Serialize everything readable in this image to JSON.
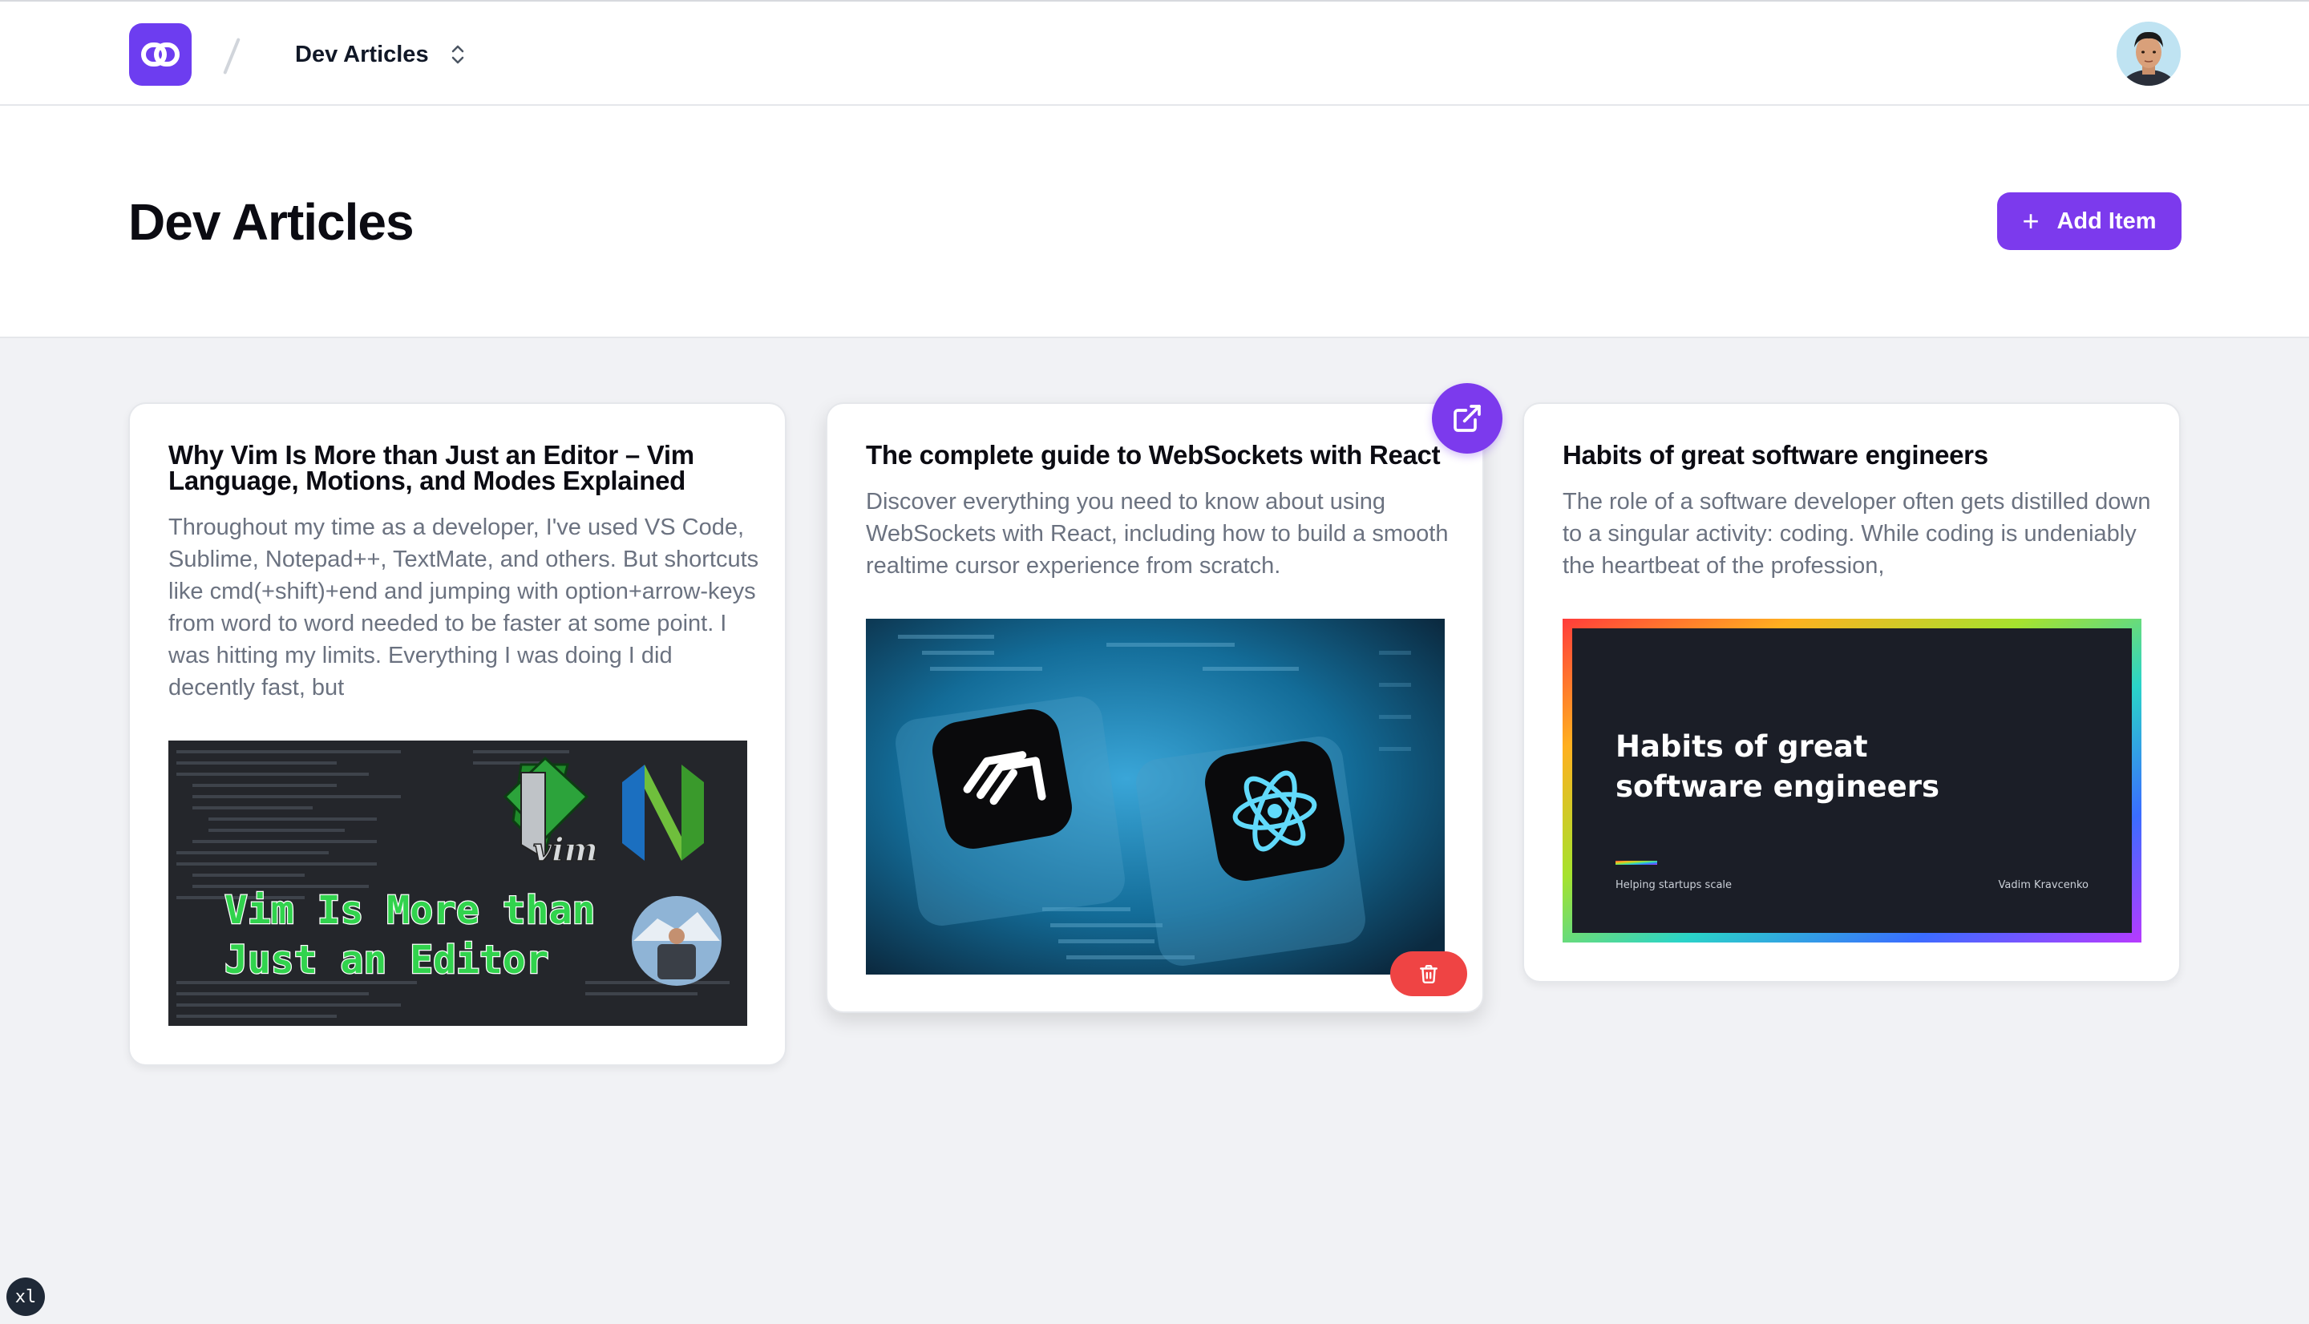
{
  "topbar": {
    "workspace_name": "Dev Articles",
    "logo_icon": "link-chain-icon",
    "switcher_icon": "chevron-up-down-icon",
    "avatar_icon": "user-avatar"
  },
  "header": {
    "title": "Dev Articles",
    "add_button_label": "Add Item",
    "add_button_icon": "plus-icon"
  },
  "cards": [
    {
      "title": "Why Vim Is More than Just an Editor – Vim Language, Motions, and Modes Explained",
      "description": "Throughout my time as a developer, I've used VS Code, Sublime, Notepad++, TextMate, and others. But shortcuts like cmd(+shift)+end and jumping with option+arrow-keys from word to word needed to be faster at some point. I was hitting my limits. Everything I was doing I did decently fast, but",
      "image": {
        "line1": "Vim Is More than",
        "line2": "Just an Editor",
        "logo_text": "vim"
      }
    },
    {
      "title": "The complete guide to WebSockets with React",
      "description": "Discover everything you need to know about using WebSockets with React, including how to build a smooth realtime cursor experience from scratch.",
      "open_icon": "external-link-icon",
      "delete_icon": "trash-icon"
    },
    {
      "title": "Habits of great software engineers",
      "description": "The role of a software developer often gets distilled down to a singular activity: coding. While coding is undeniably the heartbeat of the profession,",
      "image": {
        "headline_line1": "Habits of great",
        "headline_line2": "software engineers",
        "footer_left": "Helping startups scale",
        "footer_right": "Vadim Kravcenko"
      }
    }
  ],
  "screen_badge": "xl",
  "colors": {
    "accent": "#7c3aed",
    "danger": "#ef4444",
    "background": "#f1f2f5"
  }
}
